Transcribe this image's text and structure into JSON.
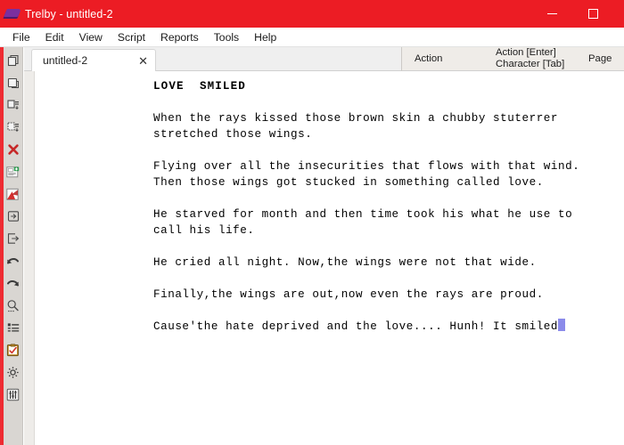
{
  "window": {
    "title": "Trelby - untitled-2",
    "app_icon": "trelby-logo-icon",
    "minimize_label": "—",
    "maximize_label": "□"
  },
  "menubar": {
    "items": [
      {
        "label": "File"
      },
      {
        "label": "Edit"
      },
      {
        "label": "View"
      },
      {
        "label": "Script"
      },
      {
        "label": "Reports"
      },
      {
        "label": "Tools"
      },
      {
        "label": "Help"
      }
    ]
  },
  "toolbar": {
    "items": [
      {
        "name": "new-script-icon",
        "title": "New"
      },
      {
        "name": "open-script-icon",
        "title": "Open"
      },
      {
        "name": "save-script-icon",
        "title": "Save"
      },
      {
        "name": "save-as-icon",
        "title": "Save As"
      },
      {
        "name": "close-script-icon",
        "title": "Close"
      },
      {
        "name": "export-html-icon",
        "title": "Export HTML"
      },
      {
        "name": "export-pdf-icon",
        "title": "Export PDF"
      },
      {
        "name": "import-icon",
        "title": "Import"
      },
      {
        "name": "export-icon",
        "title": "Export"
      },
      {
        "name": "undo-icon",
        "title": "Undo"
      },
      {
        "name": "redo-icon",
        "title": "Redo"
      },
      {
        "name": "find-icon",
        "title": "Find & Replace"
      },
      {
        "name": "outline-icon",
        "title": "Script Outline"
      },
      {
        "name": "spellcheck-icon",
        "title": "Spell Checker"
      },
      {
        "name": "settings-icon",
        "title": "Settings"
      },
      {
        "name": "script-settings-icon",
        "title": "Script Settings"
      }
    ]
  },
  "tabs": [
    {
      "label": "untitled-2",
      "close_label": "✕",
      "active": true
    }
  ],
  "statusbar": {
    "element_type": "Action",
    "key_hints_line1": "Action [Enter]",
    "key_hints_line2": "Character [Tab]",
    "page_label": "Page"
  },
  "document": {
    "blocks": [
      {
        "type": "heading",
        "lines": [
          "LOVE  SMILED"
        ]
      },
      {
        "type": "action",
        "lines": [
          "When the rays kissed those brown skin a chubby stuterrer",
          "stretched those wings."
        ]
      },
      {
        "type": "action",
        "lines": [
          "Flying over all the insecurities that flows with that wind.",
          "Then those wings got stucked in something called love."
        ]
      },
      {
        "type": "action",
        "lines": [
          "He starved for month and then time took his what he use to",
          "call his life."
        ]
      },
      {
        "type": "action",
        "lines": [
          "He cried all night. Now,the wings were not that wide."
        ]
      },
      {
        "type": "action",
        "lines": [
          "Finally,the wings are out,now even the rays are proud."
        ]
      },
      {
        "type": "action",
        "lines": [
          "Cause'the hate deprived and the love.... Hunh! It smiled"
        ],
        "caret_at_end": true
      }
    ]
  },
  "colors": {
    "titlebar": "#ec1c24",
    "left_stripe": "#ee2b32",
    "toolbar_bg": "#d9d6d2",
    "tabstrip_bg": "#efefef",
    "statuspanel_bg": "#efece8",
    "page_bg": "#ffffff",
    "editor_bg": "#eeece9",
    "caret": "#8b8bea",
    "logo": "#7b2fa0"
  }
}
